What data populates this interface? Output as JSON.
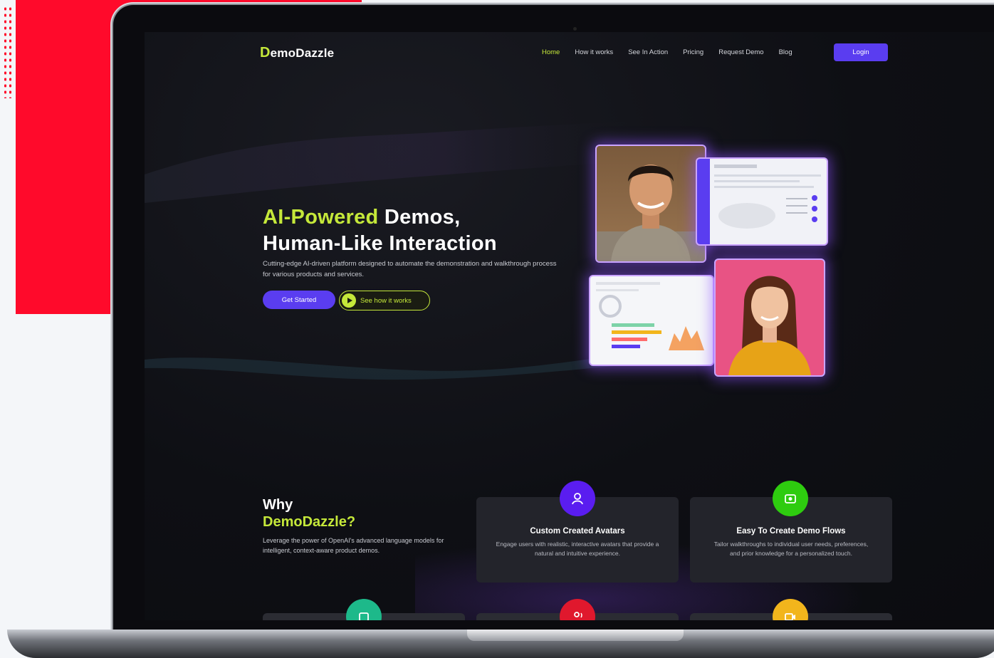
{
  "brand": {
    "logo_prefix": "D",
    "logo_rest": "emoDazzle",
    "accent": "#c5e83a",
    "primary": "#5a3df0"
  },
  "nav": {
    "items": [
      "Home",
      "How it works",
      "See In Action",
      "Pricing",
      "Request Demo",
      "Blog"
    ],
    "login": "Login"
  },
  "hero": {
    "title_highlight": "AI-Powered",
    "title_rest": " Demos,",
    "title_line2": "Human-Like Interaction",
    "subtitle": "Cutting-edge AI-driven platform designed to automate the demonstration and walkthrough process for various products and services.",
    "cta_primary": "Get Started",
    "cta_secondary": "See how it works"
  },
  "why": {
    "title_line1": "Why",
    "title_line2": "DemoDazzle?",
    "subtitle": "Leverage the power of OpenAI's advanced language models for intelligent, context-aware product demos."
  },
  "features": [
    {
      "title": "Custom Created Avatars",
      "desc": "Engage users with realistic, interactive avatars that provide a natural and intuitive experience.",
      "color": "#5a1df0",
      "icon": "avatar-icon"
    },
    {
      "title": "Easy To Create Demo Flows",
      "desc": "Tailor walkthroughs to individual user needs, preferences, and prior knowledge for a personalized touch.",
      "color": "#2ecc0f",
      "icon": "flow-icon"
    }
  ],
  "row2_icons": [
    {
      "color": "#1db98a",
      "icon": "camera-icon"
    },
    {
      "color": "#e0182d",
      "icon": "voice-icon"
    },
    {
      "color": "#f2b51c",
      "icon": "video-icon"
    }
  ]
}
